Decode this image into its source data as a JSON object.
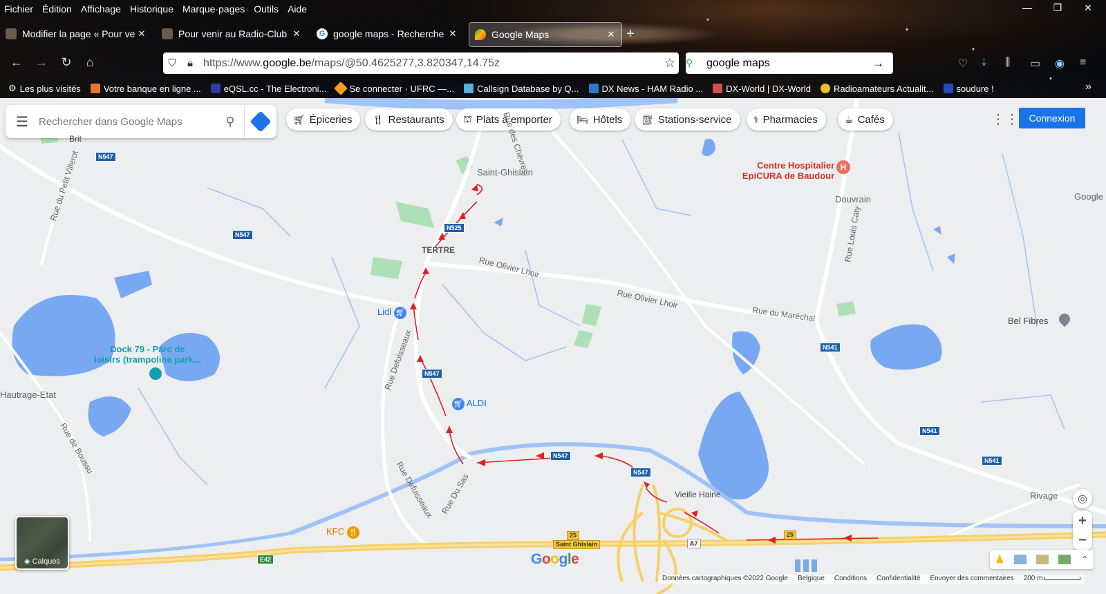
{
  "menubar": [
    "Fichier",
    "Édition",
    "Affichage",
    "Historique",
    "Marque-pages",
    "Outils",
    "Aide"
  ],
  "tabs": [
    {
      "title": "Modifier la page « Pour ver",
      "active": false
    },
    {
      "title": "Pour venir au Radio-Club -",
      "active": false
    },
    {
      "title": "google maps - Recherche G",
      "active": false
    },
    {
      "title": "Google Maps",
      "active": true
    }
  ],
  "urlbar": {
    "url_prefix": "https://www.",
    "url_domain": "google.be",
    "url_path": "/maps/@50.4625277,3.820347,14.75z"
  },
  "searchbar": {
    "query": "google maps"
  },
  "bookmarks": [
    "Les plus visités",
    "Votre banque en ligne ...",
    "eQSL.cc - The Electroni...",
    "Se connecter · UFRC —...",
    "Callsign Database by Q...",
    "DX News - HAM Radio ...",
    "DX-World | DX-World",
    "Radioamateurs Actualit...",
    "soudure !"
  ],
  "maps": {
    "search_placeholder": "Rechercher dans Google Maps",
    "chips": [
      "Épiceries",
      "Restaurants",
      "Plats à emporter",
      "Hôtels",
      "Stations-service",
      "Pharmacies",
      "Cafés"
    ],
    "login": "Connexion",
    "layers": "Calques",
    "logo": "Google",
    "footer": [
      "Données cartographiques ©2022 Google",
      "Belgique",
      "Conditions",
      "Confidentialité",
      "Envoyer des commentaires",
      "200 m"
    ],
    "places": {
      "brit": "Brit",
      "saint_ghislain": "Saint-Ghislain",
      "tertre": "TERTRE",
      "lidl": "Lidl",
      "aldi": "ALDI",
      "kfc": "KFC",
      "douvrain": "Douvrain",
      "bel_fibres": "Bel Fibres",
      "rivage": "Rivage",
      "vieille_haine": "Vieille Haine",
      "hautrage": "Hautrage-Etat",
      "google_edge": "Google",
      "dock79_1": "Dock 79 - Parc de",
      "dock79_2": "loisirs (trampoline park...",
      "hospital_1": "Centre Hospitalier",
      "hospital_2": "EpiCURA de Baudour"
    },
    "streets": {
      "olivier1": "Rue Olivier Lhoir",
      "olivier2": "Rue Olivier Lhoir",
      "marechal": "Rue du Maréchal",
      "louis_caty": "Rue Louis Caty",
      "defuisseaux1": "Rue Defuisseaux",
      "defuisseaux2": "Rue Defuisseaux",
      "du_sas": "Rue Du Sas",
      "boussu": "Rue de Boussu",
      "petit_villerot": "Rue du Petit Villerot",
      "chevres": "Rue des Chèvres"
    },
    "shields": {
      "n547": "N547",
      "n525": "N525",
      "n541": "N541",
      "e42": "E42",
      "a7": "A7",
      "r25": "25",
      "saint_ghislain": "Saint Ghislain"
    }
  }
}
